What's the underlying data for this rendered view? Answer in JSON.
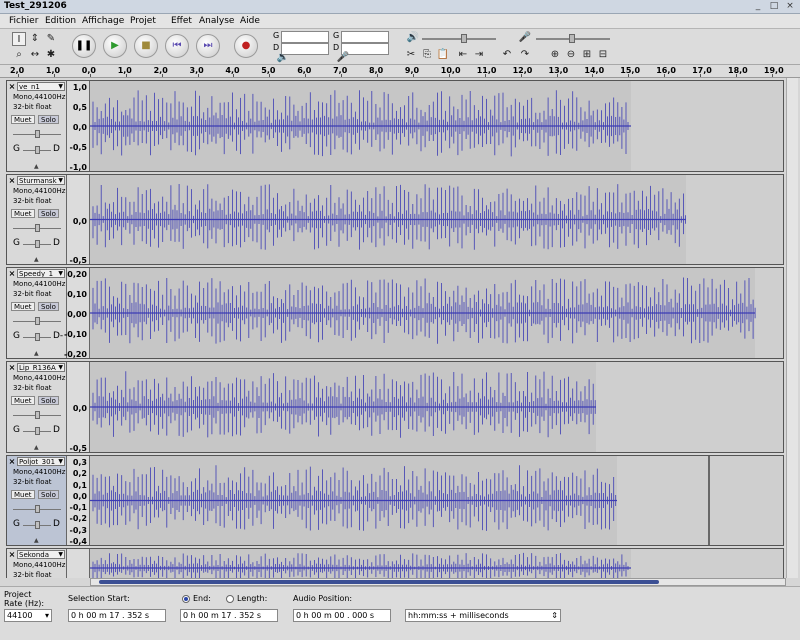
{
  "window": {
    "title": "Test_291206"
  },
  "menu": [
    "Fichier",
    "Edition",
    "Affichage",
    "Projet",
    "Effet",
    "Analyse",
    "Aide"
  ],
  "meters": {
    "left_label": "G",
    "right_label": "D",
    "scale": [
      "-24",
      "0",
      "-24",
      "0"
    ]
  },
  "ruler_labels": [
    "2,0",
    "1,0",
    "0,0",
    "1,0",
    "2,0",
    "3,0",
    "4,0",
    "5,0",
    "6,0",
    "7,0",
    "8,0",
    "9,0",
    "10,0",
    "11,0",
    "12,0",
    "13,0",
    "14,0",
    "15,0",
    "16,0",
    "17,0",
    "18,0",
    "19,0"
  ],
  "tracks": [
    {
      "name": "ve_n1",
      "rate": "Mono,44100Hz",
      "depth": "32-bit float",
      "mute": "Muet",
      "solo": "Solo",
      "g": "G",
      "d": "D",
      "scale": [
        "1,0",
        "0,5",
        "0,0",
        "-0,5",
        "-1,0"
      ],
      "end_fraction": 0.78,
      "selected": false
    },
    {
      "name": "Sturmansk",
      "rate": "Mono,44100Hz",
      "depth": "32-bit float",
      "mute": "Muet",
      "solo": "Solo",
      "g": "G",
      "d": "D",
      "scale": [
        "",
        "",
        "0,0",
        "",
        "-0,5"
      ],
      "end_fraction": 0.86,
      "selected": false
    },
    {
      "name": "Speedy_1",
      "rate": "Mono,44100Hz",
      "depth": "32-bit float",
      "mute": "Muet",
      "solo": "Solo",
      "g": "G",
      "d": "D-",
      "scale": [
        "0,20",
        "0,10",
        "0,00",
        "-0,10",
        "-0,20"
      ],
      "end_fraction": 0.96,
      "selected": false
    },
    {
      "name": "Lip_R136A",
      "rate": "Mono,44100Hz",
      "depth": "32-bit float",
      "mute": "Muet",
      "solo": "Solo",
      "g": "G",
      "d": "D",
      "scale": [
        "",
        "",
        "0,0",
        "",
        "-0,5"
      ],
      "end_fraction": 0.73,
      "selected": false
    },
    {
      "name": "Poljot_301",
      "rate": "Mono,44100Hz",
      "depth": "32-bit float",
      "mute": "Muet",
      "solo": "Solo",
      "g": "G",
      "d": "D",
      "scale": [
        "0,3",
        "0,2",
        "0,1",
        "0,0",
        "-0,1",
        "-0,2",
        "-0,3",
        "-0,4"
      ],
      "end_fraction": 0.76,
      "selected": true
    },
    {
      "name": "Sekonda_",
      "rate": "Mono,44100Hz",
      "depth": "32-bit float",
      "mute": "Muet",
      "solo": "Solo",
      "g": "G",
      "d": "D",
      "scale": [],
      "end_fraction": 0.78,
      "selected": false
    }
  ],
  "selection_bar": {
    "rate_label_1": "Project",
    "rate_label_2": "Rate (Hz):",
    "rate_value": "44100",
    "selection_start_label": "Selection Start:",
    "end_label": "End:",
    "length_label": "Length:",
    "audio_position_label": "Audio Position:",
    "start_value": "0 h 00 m 17 . 352 s",
    "end_value": "0 h 00 m 17 . 352 s",
    "position_value": "0 h 00 m 00 . 000 s",
    "format_value": "hh:mm:ss + milliseconds"
  },
  "colors": {
    "waveform": "#3c3cb4",
    "waveform_bg": "#c6c6c6",
    "selection": "#2a46a8"
  }
}
